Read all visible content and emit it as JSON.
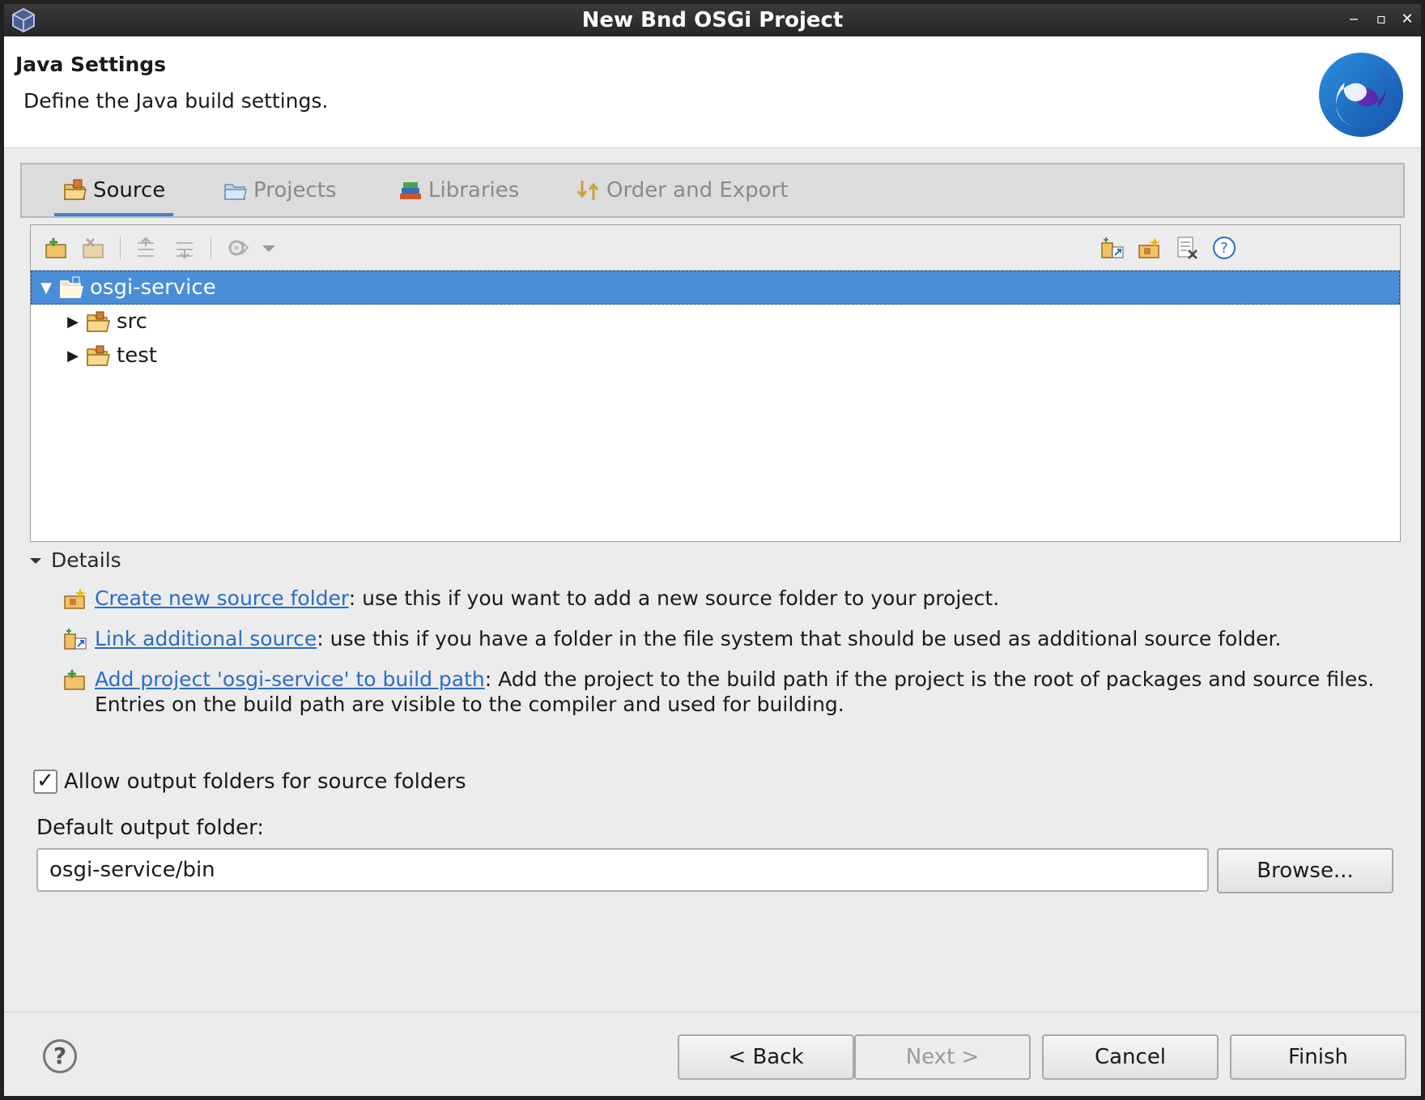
{
  "window": {
    "title": "New Bnd OSGi Project",
    "minimize": "‒",
    "maximize": "▫",
    "close": "✕"
  },
  "header": {
    "title": "Java Settings",
    "description": "Define the Java build settings."
  },
  "tabs": [
    {
      "label": "Source",
      "active": true
    },
    {
      "label": "Projects",
      "active": false
    },
    {
      "label": "Libraries",
      "active": false
    },
    {
      "label": "Order and Export",
      "active": false
    }
  ],
  "tree": {
    "root": "osgi-service",
    "children": [
      "src",
      "test"
    ]
  },
  "details": {
    "heading": "Details",
    "items": [
      {
        "link": "Create new source folder",
        "text": ": use this if you want to add a new source folder to your project."
      },
      {
        "link": "Link additional source",
        "text": ": use this if you have a folder in the file system that should be used as additional source folder."
      },
      {
        "link": "Add project 'osgi-service' to build path",
        "text": ": Add the project to the build path if the project is the root of packages and source files. Entries on the build path are visible to the compiler and used for building."
      }
    ]
  },
  "options": {
    "allow_output_label": "Allow output folders for source folders",
    "allow_output_checked": true
  },
  "output": {
    "label": "Default output folder:",
    "value": "osgi-service/bin",
    "browse": "Browse..."
  },
  "footer": {
    "help": "?",
    "back": "< Back",
    "next": "Next >",
    "cancel": "Cancel",
    "finish": "Finish"
  },
  "colors": {
    "accent": "#4a8ed8",
    "link": "#2a6dc7"
  }
}
